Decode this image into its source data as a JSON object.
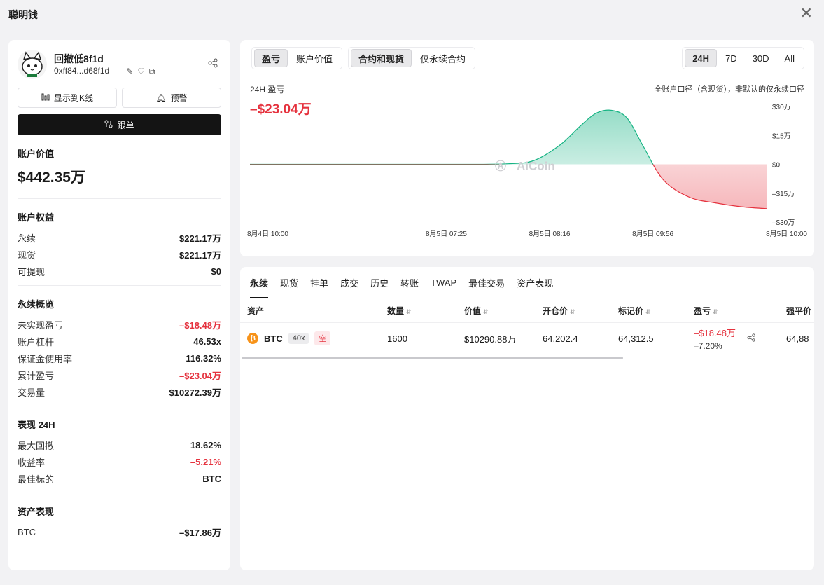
{
  "window": {
    "title": "聪明钱",
    "close_glyph": "✕"
  },
  "profile": {
    "name": "回撤低8f1d",
    "address": "0xff84...d68f1d",
    "show_kline_label": "显示到K线",
    "alert_label": "预警",
    "follow_label": "跟单"
  },
  "account_value": {
    "title": "账户价值",
    "value": "$442.35万"
  },
  "equity": {
    "title": "账户权益",
    "rows": [
      {
        "k": "永续",
        "v": "$221.17万"
      },
      {
        "k": "现货",
        "v": "$221.17万"
      },
      {
        "k": "可提现",
        "v": "$0"
      }
    ]
  },
  "perp_overview": {
    "title": "永续概览",
    "rows": [
      {
        "k": "未实现盈亏",
        "v": "–$18.48万",
        "neg": true
      },
      {
        "k": "账户杠杆",
        "v": "46.53x"
      },
      {
        "k": "保证金使用率",
        "v": "116.32%"
      },
      {
        "k": "累计盈亏",
        "v": "–$23.04万",
        "neg": true
      },
      {
        "k": "交易量",
        "v": "$10272.39万"
      }
    ]
  },
  "performance": {
    "title": "表现 24H",
    "rows": [
      {
        "k": "最大回撤",
        "v": "18.62%"
      },
      {
        "k": "收益率",
        "v": "–5.21%",
        "neg": true
      },
      {
        "k": "最佳标的",
        "v": "BTC"
      }
    ]
  },
  "asset_performance": {
    "title": "资产表现",
    "rows": [
      {
        "k": "BTC",
        "v": "–$17.86万"
      }
    ]
  },
  "chart_tabs": {
    "group1": [
      "盈亏",
      "账户价值"
    ],
    "group2": [
      "合约和现货",
      "仅永续合约"
    ],
    "ranges": [
      "24H",
      "7D",
      "30D",
      "All"
    ]
  },
  "pnl": {
    "label": "24H 盈亏",
    "value": "–$23.04万",
    "scope_note": "全账户口径（含现货），非默认的仅永续口径"
  },
  "watermark": "AiCoin",
  "colors": {
    "positive": "#16b383",
    "negative": "#e5323e",
    "accent": "#141414"
  },
  "chart_data": {
    "type": "area",
    "title": "24H 盈亏",
    "xlabel": "",
    "ylabel": "",
    "x_ticks": [
      "8月4日 10:00",
      "8月5日 07:25",
      "8月5日 08:16",
      "8月5日 09:56",
      "8月5日 10:00"
    ],
    "y_ticks": [
      "$30万",
      "$15万",
      "$0",
      "–$15万",
      "–$30万"
    ],
    "ylim": [
      -30,
      30
    ],
    "unit": "万",
    "series": [
      {
        "x": [
          0,
          0.2,
          0.4,
          0.5,
          0.55,
          0.6,
          0.64,
          0.67,
          0.7,
          0.73,
          0.76,
          0.8,
          0.85,
          0.9,
          0.95,
          1.0
        ],
        "values": [
          0,
          0,
          0,
          0.3,
          2,
          10,
          20,
          26.5,
          28,
          24,
          10,
          -8,
          -17,
          -20,
          -22,
          -23.04
        ]
      }
    ]
  },
  "bottom_tabs": [
    "永续",
    "现货",
    "挂单",
    "成交",
    "历史",
    "转账",
    "TWAP",
    "最佳交易",
    "资产表现"
  ],
  "table": {
    "headers": [
      "资产",
      "数量",
      "价值",
      "开仓价",
      "标记价",
      "盈亏",
      "强平价"
    ],
    "rows": [
      {
        "asset": "BTC",
        "leverage": "40x",
        "side": "空",
        "qty": "1600",
        "value": "$10290.88万",
        "entry": "64,202.4",
        "mark": "64,312.5",
        "pnl": "–$18.48万",
        "pnl_pct": "–7.20%",
        "liq": "64,88"
      }
    ]
  }
}
